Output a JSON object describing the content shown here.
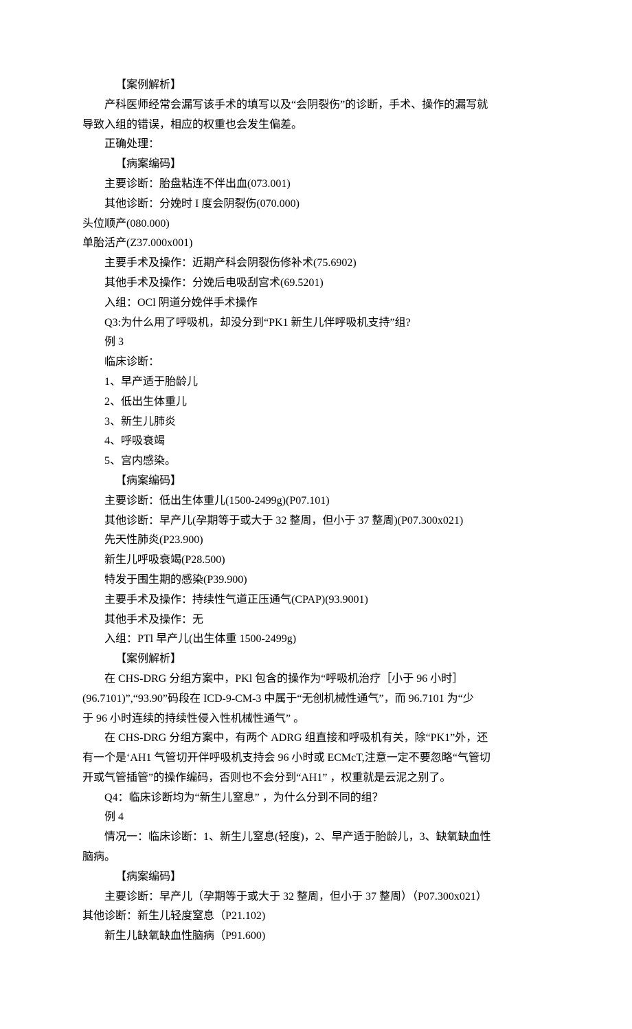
{
  "lines": [
    {
      "cls": "indent-3",
      "text": "【案例解析】"
    },
    {
      "cls": "para",
      "text": "产科医师经常会漏写该手术的填写以及“会阴裂伤”的诊断，手术、操作的漏写就"
    },
    {
      "cls": "no-indent",
      "text": "导致入组的错误，相应的权重也会发生偏差。"
    },
    {
      "cls": "para",
      "text": "正确处理："
    },
    {
      "cls": "indent-3",
      "text": "【病案编码】"
    },
    {
      "cls": "para",
      "text": "主要诊断：胎盘粘连不伴出血(073.001)"
    },
    {
      "cls": "para",
      "text": "其他诊断：分娩时 I 度会阴裂伤(070.000)"
    },
    {
      "cls": "no-indent",
      "text": "头位顺产(080.000)"
    },
    {
      "cls": "no-indent",
      "text": "单胎活产(Z37.000x001)"
    },
    {
      "cls": "para",
      "text": "主要手术及操作：近期产科会阴裂伤修补术(75.6902)"
    },
    {
      "cls": "para",
      "text": "其他手术及操作：分娩后电吸刮宫术(69.5201)"
    },
    {
      "cls": "para",
      "text": "入组：OCl 阴道分娩伴手术操作"
    },
    {
      "cls": "para",
      "text": "Q3:为什么用了呼吸机，却没分到“PK1 新生儿伴呼吸机支持”组?"
    },
    {
      "cls": "para",
      "text": "例 3"
    },
    {
      "cls": "para",
      "text": "临床诊断："
    },
    {
      "cls": "para",
      "text": "1、早产适于胎龄儿"
    },
    {
      "cls": "para",
      "text": "2、低出生体重儿"
    },
    {
      "cls": "para",
      "text": "3、新生儿肺炎"
    },
    {
      "cls": "para",
      "text": "4、呼吸衰竭"
    },
    {
      "cls": "para",
      "text": "5、宫内感染。"
    },
    {
      "cls": "indent-3",
      "text": "【病案编码】"
    },
    {
      "cls": "para",
      "text": "主要诊断：低出生体重儿(1500-2499g)(P07.101)"
    },
    {
      "cls": "para",
      "text": "其他诊断：早产儿(孕期等于或大于 32 整周，但小于 37 整周)(P07.300x021)"
    },
    {
      "cls": "para",
      "text": "先天性肺炎(P23.900)"
    },
    {
      "cls": "para",
      "text": "新生儿呼吸衰竭(P28.500)"
    },
    {
      "cls": "para",
      "text": "特发于围生期的感染(P39.900)"
    },
    {
      "cls": "para",
      "text": "主要手术及操作：持续性气道正压通气(CPAP)(93.9001)"
    },
    {
      "cls": "para",
      "text": "其他手术及操作：无"
    },
    {
      "cls": "para",
      "text": "入组：PTl 早产儿(出生体重 1500-2499g)"
    },
    {
      "cls": "indent-3",
      "text": "【案例解析】"
    },
    {
      "cls": "para",
      "text": "在 CHS-DRG 分组方案中，PKl 包含的操作为“呼吸机治疗［小于 96 小时］"
    },
    {
      "cls": "no-indent",
      "text": "(96.7101)”,“93.90”码段在 ICD-9-CM-3 中属于“无创机械性通气”，而 96.7101 为“少"
    },
    {
      "cls": "no-indent",
      "text": "于 96 小时连续的持续性侵入性机械性通气” 。"
    },
    {
      "cls": "para",
      "text": "在 CHS-DRG 分组方案中，有两个 ADRG 组直接和呼吸机有关，除“PK1”外，还"
    },
    {
      "cls": "no-indent",
      "text": "有一个是‘AH1 气管切开伴呼吸机支持会 96 小时或 ECMcT,注意一定不要忽略“气管切"
    },
    {
      "cls": "no-indent",
      "text": "开或气管插管”的操作编码，否则也不会分到“AH1” ，权重就是云泥之别了。"
    },
    {
      "cls": "para",
      "text": "Q4：临床诊断均为“新生儿窒息” ，为什么分到不同的组？"
    },
    {
      "cls": "para",
      "text": "例 4"
    },
    {
      "cls": "para",
      "text": "情况一：临床诊断：1、新生儿窒息(轻度)，2、早产适于胎龄儿，3、缺氧缺血性"
    },
    {
      "cls": "no-indent",
      "text": "脑病。"
    },
    {
      "cls": "indent-3",
      "text": "【病案编码】"
    },
    {
      "cls": "para",
      "text": "主要诊断：早产儿（孕期等于或大于 32 整周，但小于 37 整周）（P07.300x021）"
    },
    {
      "cls": "no-indent",
      "text": "其他诊断：新生儿轻度窒息（P21.102)"
    },
    {
      "cls": "para",
      "text": "新生儿缺氧缺血性脑病（P91.600)"
    }
  ]
}
